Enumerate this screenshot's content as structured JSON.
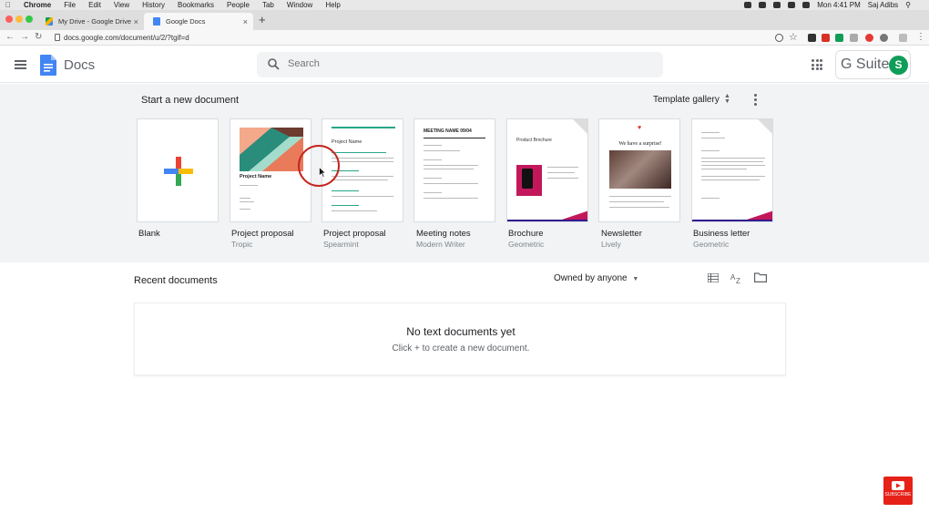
{
  "mac_menubar": {
    "apple": "",
    "app": "Chrome",
    "items": [
      "File",
      "Edit",
      "View",
      "History",
      "Bookmarks",
      "People",
      "Tab",
      "Window",
      "Help"
    ],
    "clock": "Mon 4:41 PM",
    "user": "Saj Adibs"
  },
  "browser": {
    "tabs": [
      {
        "title": "My Drive - Google Drive"
      },
      {
        "title": "Google Docs"
      }
    ],
    "new_tab": "+",
    "url": "docs.google.com/document/u/2/?tgif=d"
  },
  "header": {
    "product_name": "Docs",
    "search_placeholder": "Search",
    "gsuite_label": "G Suite",
    "avatar_letter": "S"
  },
  "templates": {
    "heading": "Start a new document",
    "gallery_label": "Template gallery",
    "items": [
      {
        "name": "Blank",
        "sub": ""
      },
      {
        "name": "Project proposal",
        "sub": "Tropic"
      },
      {
        "name": "Project proposal",
        "sub": "Spearmint"
      },
      {
        "name": "Meeting notes",
        "sub": "Modern Writer"
      },
      {
        "name": "Brochure",
        "sub": "Geometric"
      },
      {
        "name": "Newsletter",
        "sub": "Lively"
      },
      {
        "name": "Business letter",
        "sub": "Geometric"
      }
    ],
    "thumbs": {
      "tropic_title": "Project Name",
      "spearmint_title": "Project Name",
      "meeting_title": "MEETING NAME 09/04",
      "brochure_title": "Product Brochure",
      "newsletter_title": "We have a surprise!"
    }
  },
  "recent": {
    "heading": "Recent documents",
    "owner_filter": "Owned by anyone",
    "empty_title": "No text documents yet",
    "empty_sub": "Click + to create a new document."
  },
  "overlay": {
    "subscribe": "SUBSCRIBE"
  },
  "colors": {
    "accent_green": "#0f9d58",
    "docs_blue": "#4285f4",
    "band_gray": "#f1f3f4"
  }
}
